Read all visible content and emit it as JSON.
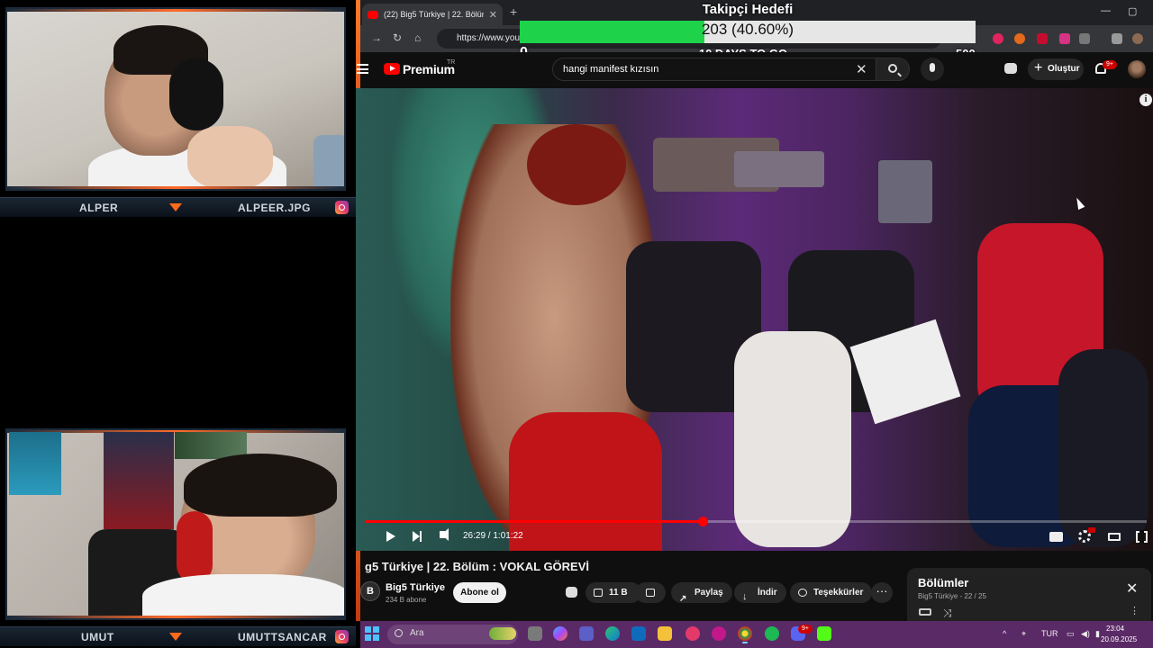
{
  "stream": {
    "cam_top": {
      "left_name": "ALPER",
      "right_name": "ALPEER.JPG"
    },
    "cam_bottom": {
      "left_name": "UMUT",
      "right_name": "UMUTTSANCAR"
    },
    "accent_color": "#ff6a1a"
  },
  "goal": {
    "title": "Takipçi Hedefi",
    "value_text": "203 (40.60%)",
    "fraction": 0.406,
    "min": "0",
    "max": "500",
    "days_left": "10 DAYS TO GO"
  },
  "browser": {
    "tab_title": "(22) Big5 Türkiye | 22. Bölüm : V",
    "url": "https://www.yout"
  },
  "youtube": {
    "brand": "Premium",
    "region": "TR",
    "search_query": "hangi manifest kızısın",
    "create_label": "Oluştur",
    "notif_count": "9+",
    "player": {
      "time": "26:29 / 1:01:22",
      "progress": 0.4315
    },
    "video_title": "g5 Türkiye | 22. Bölüm : VOKAL GÖREVİ",
    "channel": {
      "avatar_letter": "B",
      "name": "Big5 Türkiye",
      "subs": "234 B abone",
      "subscribe_label": "Abone ol"
    },
    "actions": {
      "likes": "11 B",
      "share": "Paylaş",
      "download": "İndir",
      "thanks": "Teşekkürler",
      "more": "···"
    },
    "chapters": {
      "title": "Bölümler",
      "subtitle": "Big5 Türkiye - 22 / 25"
    }
  },
  "taskbar": {
    "search_placeholder": "Ara",
    "language": "TUR",
    "time": "23:04",
    "date": "20.09.2025",
    "discord_badge": "9+"
  }
}
